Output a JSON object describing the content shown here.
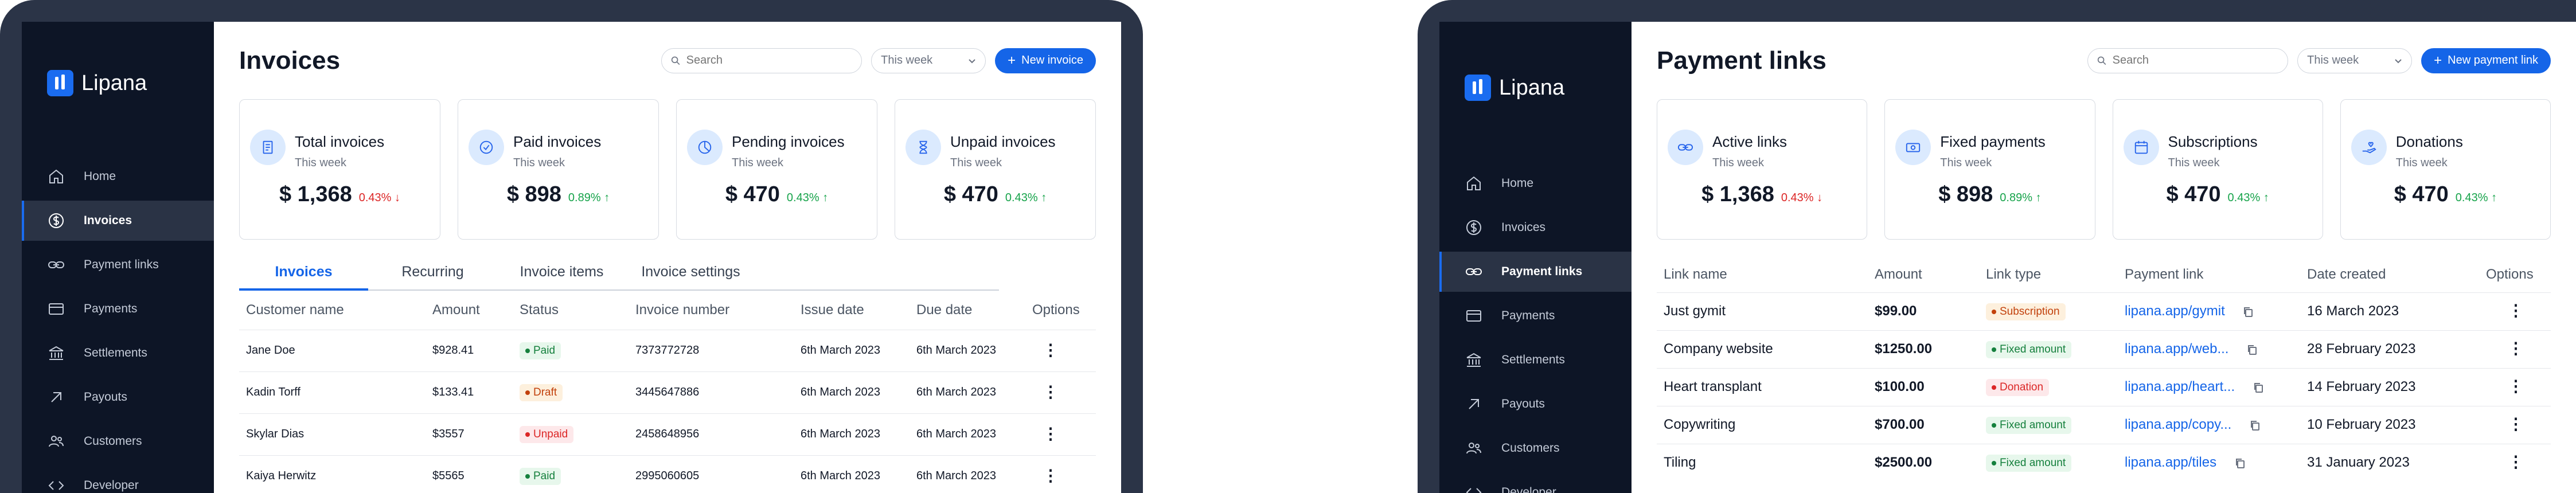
{
  "brand": {
    "name": "Lipana",
    "accent": "#1565e8",
    "sidebar_bg": "#0d1526"
  },
  "left": {
    "nav": [
      {
        "label": "Home",
        "icon": "home-icon",
        "active": false
      },
      {
        "label": "Invoices",
        "icon": "dollar-icon",
        "active": true
      },
      {
        "label": "Payment links",
        "icon": "link-icon",
        "active": false
      },
      {
        "label": "Payments",
        "icon": "card-icon",
        "active": false
      },
      {
        "label": "Settlements",
        "icon": "bank-icon",
        "active": false
      },
      {
        "label": "Payouts",
        "icon": "arrow-up-right-icon",
        "active": false
      },
      {
        "label": "Customers",
        "icon": "users-icon",
        "active": false
      },
      {
        "label": "Developer",
        "icon": "code-icon",
        "active": false
      }
    ],
    "title": "Invoices",
    "search_placeholder": "Search",
    "period": "This week",
    "new_button": "New invoice",
    "stats": [
      {
        "title": "Total invoices",
        "sub": "This week",
        "value": "$ 1,368",
        "change": "0.43%",
        "direction": "down",
        "icon": "receipt-icon"
      },
      {
        "title": "Paid invoices",
        "sub": "This week",
        "value": "$ 898",
        "change": "0.89%",
        "direction": "up",
        "icon": "check-circle-icon"
      },
      {
        "title": "Pending invoices",
        "sub": "This week",
        "value": "$ 470",
        "change": "0.43%",
        "direction": "up",
        "icon": "pie-icon"
      },
      {
        "title": "Unpaid invoices",
        "sub": "This week",
        "value": "$ 470",
        "change": "0.43%",
        "direction": "up",
        "icon": "hourglass-icon"
      }
    ],
    "tabs": [
      "Invoices",
      "Recurring",
      "Invoice items",
      "Invoice settings"
    ],
    "columns": [
      "Customer name",
      "Amount",
      "Status",
      "Invoice number",
      "Issue date",
      "Due date",
      "Options"
    ],
    "rows": [
      {
        "customer": "Jane Doe",
        "amount": "$928.41",
        "status": "Paid",
        "tone": "green",
        "number": "7373772728",
        "issue": "6th March 2023",
        "due": "6th March 2023"
      },
      {
        "customer": "Kadin Torff",
        "amount": "$133.41",
        "status": "Draft",
        "tone": "orange",
        "number": "3445647886",
        "issue": "6th March 2023",
        "due": "6th March 2023"
      },
      {
        "customer": "Skylar Dias",
        "amount": "$3557",
        "status": "Unpaid",
        "tone": "red",
        "number": "2458648956",
        "issue": "6th March 2023",
        "due": "6th March 2023"
      },
      {
        "customer": "Kaiya Herwitz",
        "amount": "$5565",
        "status": "Paid",
        "tone": "green",
        "number": "2995060605",
        "issue": "6th March 2023",
        "due": "6th March 2023"
      }
    ]
  },
  "right": {
    "nav": [
      {
        "label": "Home",
        "icon": "home-icon",
        "active": false
      },
      {
        "label": "Invoices",
        "icon": "dollar-icon",
        "active": false
      },
      {
        "label": "Payment links",
        "icon": "link-icon",
        "active": true
      },
      {
        "label": "Payments",
        "icon": "card-icon",
        "active": false
      },
      {
        "label": "Settlements",
        "icon": "bank-icon",
        "active": false
      },
      {
        "label": "Payouts",
        "icon": "arrow-up-right-icon",
        "active": false
      },
      {
        "label": "Customers",
        "icon": "users-icon",
        "active": false
      },
      {
        "label": "Developer",
        "icon": "code-icon",
        "active": false
      }
    ],
    "title": "Payment links",
    "search_placeholder": "Search",
    "period": "This week",
    "new_button": "New payment link",
    "stats": [
      {
        "title": "Active links",
        "sub": "This week",
        "value": "$ 1,368",
        "change": "0.43%",
        "direction": "down",
        "icon": "link-icon"
      },
      {
        "title": "Fixed payments",
        "sub": "This week",
        "value": "$ 898",
        "change": "0.89%",
        "direction": "up",
        "icon": "cash-icon"
      },
      {
        "title": "Subscriptions",
        "sub": "This week",
        "value": "$ 470",
        "change": "0.43%",
        "direction": "up",
        "icon": "calendar-icon"
      },
      {
        "title": "Donations",
        "sub": "This week",
        "value": "$ 470",
        "change": "0.43%",
        "direction": "up",
        "icon": "hand-heart-icon"
      }
    ],
    "columns": [
      "Link name",
      "Amount",
      "Link type",
      "Payment link",
      "Date created",
      "Options"
    ],
    "rows": [
      {
        "name": "Just gymit",
        "amount": "$99.00",
        "type": "Subscription",
        "tone": "orange",
        "link": "lipana.app/gymit",
        "date": "16 March 2023"
      },
      {
        "name": "Company website",
        "amount": "$1250.00",
        "type": "Fixed amount",
        "tone": "green",
        "link": "lipana.app/web...",
        "date": "28 February 2023"
      },
      {
        "name": "Heart transplant",
        "amount": "$100.00",
        "type": "Donation",
        "tone": "red",
        "link": "lipana.app/heart...",
        "date": "14 February 2023"
      },
      {
        "name": "Copywriting",
        "amount": "$700.00",
        "type": "Fixed amount",
        "tone": "green",
        "link": "lipana.app/copy...",
        "date": "10 February 2023"
      },
      {
        "name": "Tiling",
        "amount": "$2500.00",
        "type": "Fixed amount",
        "tone": "green",
        "link": "lipana.app/tiles",
        "date": "31 January 2023"
      }
    ]
  }
}
